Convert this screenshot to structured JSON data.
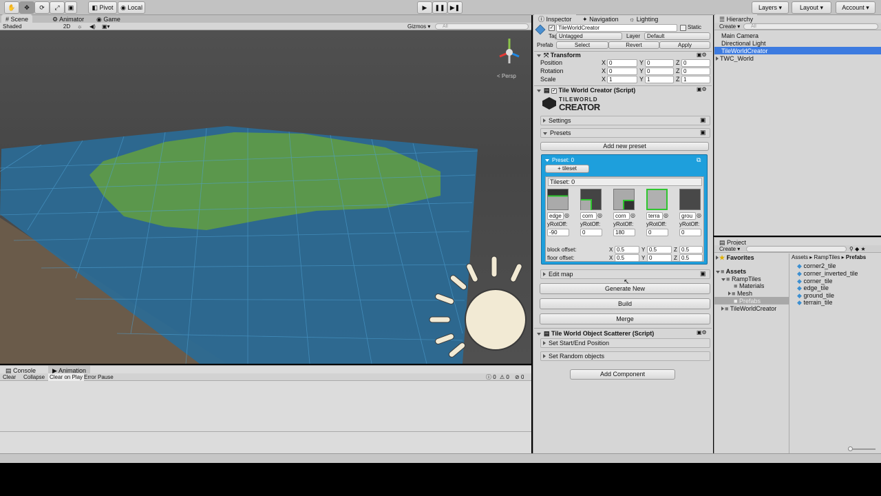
{
  "toolbar": {
    "pivot": "Pivot",
    "local": "Local",
    "layers": "Layers",
    "layout": "Layout",
    "account": "Account"
  },
  "scene": {
    "tabs": [
      "Scene",
      "Animator",
      "Game"
    ],
    "shading": "Shaded",
    "mode_2d": "2D",
    "gizmos": "Gizmos",
    "search_placeholder": "All",
    "persp": "Persp"
  },
  "console": {
    "tabs": [
      "Console",
      "Animation"
    ],
    "buttons": [
      "Clear",
      "Collapse",
      "Clear on Play",
      "Error Pause"
    ],
    "counts": [
      "0",
      "0",
      "0"
    ]
  },
  "inspector": {
    "tabs": [
      "Inspector",
      "Navigation",
      "Lighting"
    ],
    "object_name": "TileWorldCreator",
    "static_label": "Static",
    "tag_label": "Tag",
    "tag_value": "Untagged",
    "layer_label": "Layer",
    "layer_value": "Default",
    "prefab_label": "Prefab",
    "prefab_buttons": [
      "Select",
      "Revert",
      "Apply"
    ],
    "transform": {
      "title": "Transform",
      "rows": [
        {
          "label": "Position",
          "x": "0",
          "y": "0",
          "z": "0"
        },
        {
          "label": "Rotation",
          "x": "0",
          "y": "0",
          "z": "0"
        },
        {
          "label": "Scale",
          "x": "1",
          "y": "1",
          "z": "1"
        }
      ],
      "axis": [
        "X",
        "Y",
        "Z"
      ]
    },
    "twc": {
      "title": "Tile World Creator (Script)",
      "logo_top": "TILEWORLD",
      "logo_bottom": "CREATOR",
      "settings": "Settings",
      "presets": "Presets",
      "add_preset": "Add new preset",
      "preset_title": "Preset: 0",
      "add_tileset": "+ tileset",
      "tileset_title": "Tileset: 0",
      "tiles": [
        {
          "name": "edge",
          "rot": "-90"
        },
        {
          "name": "corn",
          "rot": "0"
        },
        {
          "name": "corn",
          "rot": "180"
        },
        {
          "name": "terra",
          "rot": "0"
        },
        {
          "name": "grou",
          "rot": "0"
        }
      ],
      "rot_label": "yRotOff:",
      "block_offset": {
        "label": "block offset:",
        "x": "0.5",
        "y": "0.5",
        "z": "0.5"
      },
      "floor_offset": {
        "label": "floor offset:",
        "x": "0.5",
        "y": "0",
        "z": "0.5"
      },
      "edit_map": "Edit map",
      "generate": "Generate New",
      "build": "Build",
      "merge": "Merge"
    },
    "scatter": {
      "title": "Tile World Object Scatterer (Script)",
      "start_end": "Set Start/End Position",
      "random": "Set Random objects"
    },
    "add_component": "Add Component"
  },
  "hierarchy": {
    "title": "Hierarchy",
    "create": "Create",
    "search_placeholder": "All",
    "items": [
      "Main Camera",
      "Directional Light",
      "TileWorldCreator",
      "TWC_World"
    ]
  },
  "project": {
    "title": "Project",
    "create": "Create",
    "favorites": "Favorites",
    "tree": [
      "Assets",
      "RampTiles",
      "Materials",
      "Mesh",
      "Prefabs",
      "TileWorldCreator"
    ],
    "breadcrumb": [
      "Assets",
      "RampTiles",
      "Prefabs"
    ],
    "files": [
      "corner2_tile",
      "corner_inverted_tile",
      "corner_tile",
      "edge_tile",
      "ground_tile",
      "terrain_tile"
    ]
  }
}
